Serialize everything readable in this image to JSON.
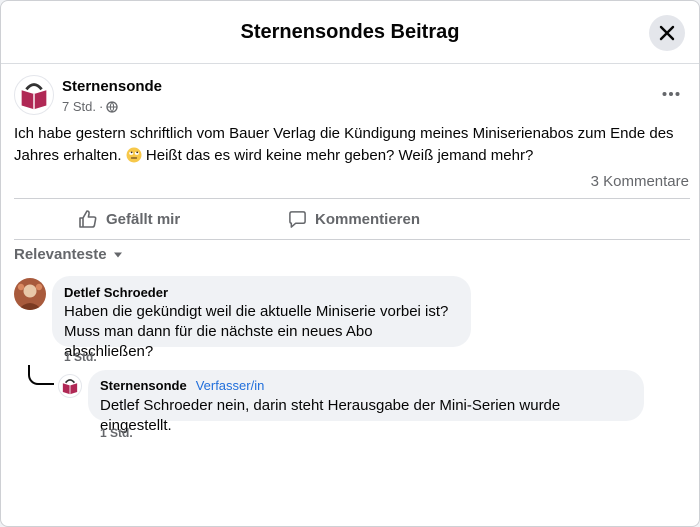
{
  "modal": {
    "title": "Sternensondes Beitrag"
  },
  "post": {
    "author": "Sternensonde",
    "time": "7 Std.",
    "separator": "·",
    "text_before_emoji": "Ich habe gestern schriftlich vom Bauer Verlag die Kündigung meines Miniserienabos zum Ende des Jahres erhalten.",
    "text_after_emoji": "Heißt das es wird keine mehr geben? Weiß jemand mehr?",
    "comment_count": "3 Kommentare"
  },
  "actions": {
    "like_label": "Gefällt mir",
    "comment_label": "Kommentieren"
  },
  "comments_sort": {
    "label": "Relevanteste"
  },
  "comments": [
    {
      "author": "Detlef Schroeder",
      "lines": [
        "Haben die gekündigt weil die aktuelle Miniserie vorbei ist?",
        "Muss man dann für die nächste ein neues Abo abschließen?"
      ],
      "time": "1 Std."
    }
  ],
  "reply": {
    "author": "Sternensonde",
    "badge": "Verfasser/in",
    "text": "Detlef Schroeder nein, darin steht Herausgabe der Mini-Serien wurde eingestellt.",
    "time": "1 Std."
  },
  "colors": {
    "accent": "#216fdb",
    "muted": "#65676b",
    "bubble": "#f0f2f5",
    "book": "#b02855"
  },
  "icons": [
    "close-icon",
    "globe-icon",
    "more-icon",
    "like-icon",
    "comment-icon",
    "caret-down-icon",
    "roll-eyes-emoji"
  ]
}
